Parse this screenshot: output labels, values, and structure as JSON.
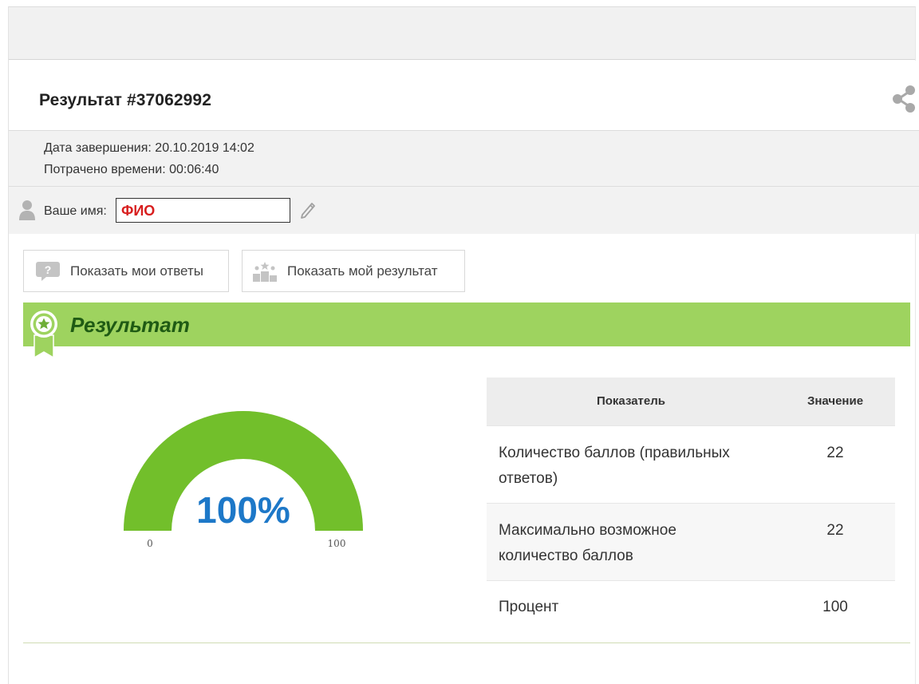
{
  "header": {
    "title": "Результат #37062992",
    "share_icon": "share-icon"
  },
  "info": {
    "completion_date": "Дата завершения: 20.10.2019 14:02",
    "time_spent": "Потрачено времени: 00:06:40"
  },
  "name": {
    "label": "Ваше имя:",
    "value": "ФИО",
    "value_color": "#d81e1e"
  },
  "buttons": {
    "show_answers": "Показать мои ответы",
    "show_result": "Показать мой результат"
  },
  "result": {
    "title": "Результат",
    "bar_color": "#9ed35f"
  },
  "gauge": {
    "value_label": "100%",
    "value": 100,
    "min": "0",
    "max": "100",
    "fill_color": "#72bf2b"
  },
  "table": {
    "headers": [
      "Показатель",
      "Значение"
    ],
    "rows": [
      {
        "label_line1": "Количество баллов (правильных",
        "label_line2": "ответов)",
        "value": "22"
      },
      {
        "label_line1": "Максимально возможное",
        "label_line2": "количество баллов",
        "value": "22"
      },
      {
        "label_line1": "Процент",
        "label_line2": "",
        "value": "100"
      }
    ]
  }
}
